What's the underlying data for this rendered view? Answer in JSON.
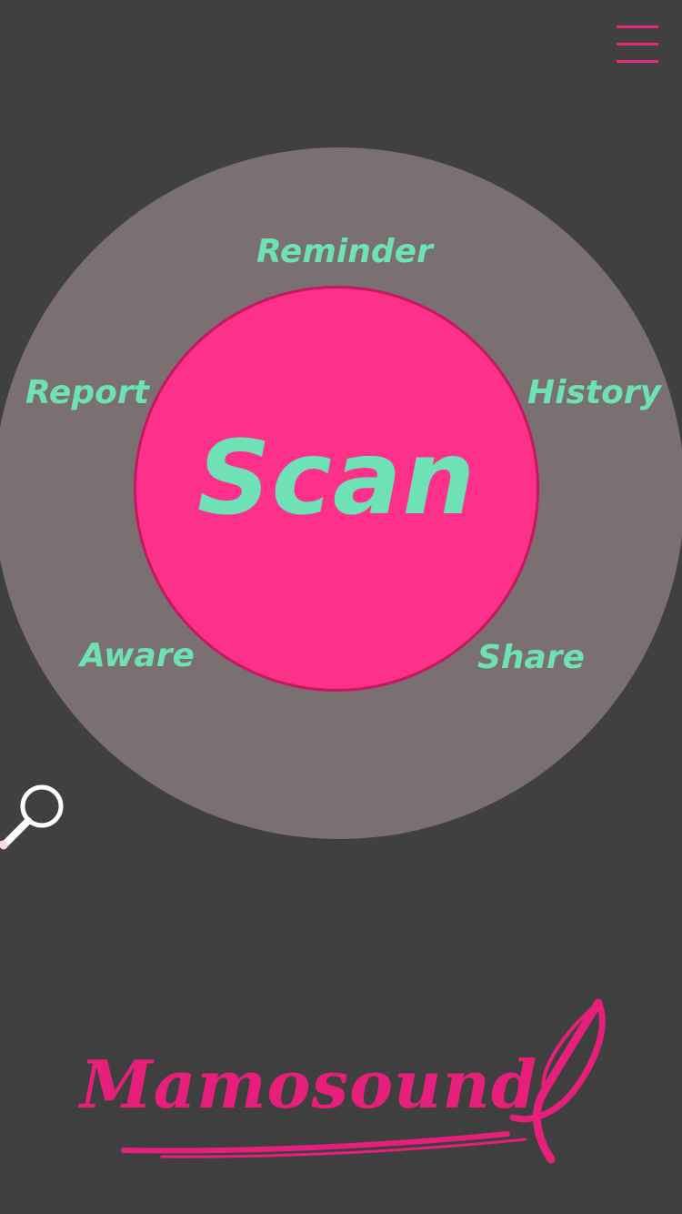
{
  "header": {
    "menu_icon": "hamburger-menu-icon"
  },
  "wheel": {
    "center_label": "Scan",
    "items": [
      {
        "label": "Reminder"
      },
      {
        "label": "Report"
      },
      {
        "label": "History"
      },
      {
        "label": "Aware"
      },
      {
        "label": "Share"
      }
    ]
  },
  "search": {
    "icon": "magnifier-icon"
  },
  "footer": {
    "logo_text": "Mamosound"
  },
  "colors": {
    "background": "#404040",
    "ring": "#7a7072",
    "scan_fill": "#fe318a",
    "scan_border": "#c5185f",
    "label_text": "#6fe1b6",
    "accent": "#e8287a"
  }
}
